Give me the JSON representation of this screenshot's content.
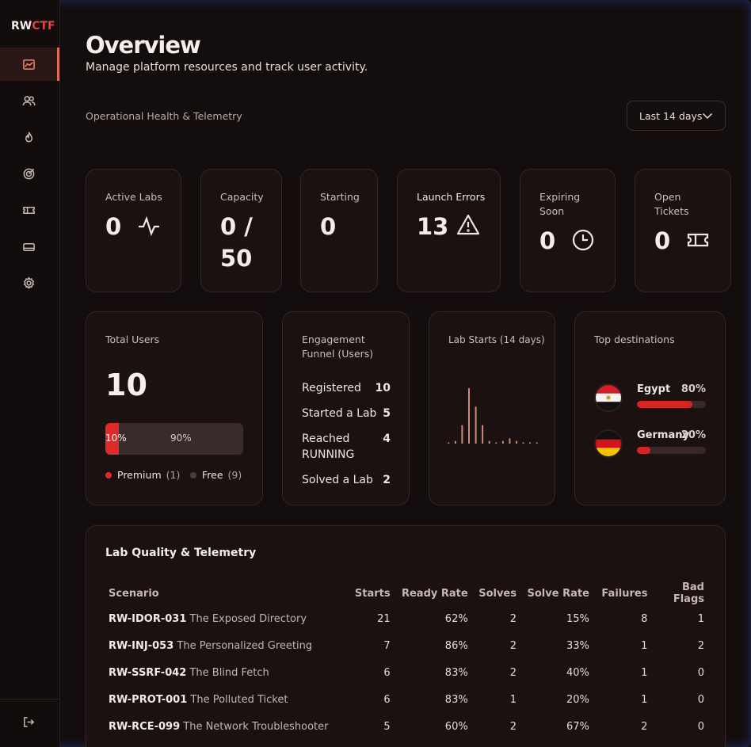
{
  "brand": {
    "part1": "RW",
    "part2": "CTF"
  },
  "nav": [
    {
      "name": "nav-overview",
      "icon": "chart-icon"
    },
    {
      "name": "nav-users",
      "icon": "users-icon"
    },
    {
      "name": "nav-flame",
      "icon": "flame-icon"
    },
    {
      "name": "nav-target",
      "icon": "target-icon"
    },
    {
      "name": "nav-tickets",
      "icon": "ticket-icon"
    },
    {
      "name": "nav-card",
      "icon": "card-icon"
    },
    {
      "name": "nav-settings",
      "icon": "gear-icon"
    }
  ],
  "header": {
    "title": "Overview",
    "subtitle": "Manage platform resources and track user activity.",
    "section_label": "Operational Health & Telemetry",
    "range": "Last 14 days"
  },
  "stats": {
    "active_labs": {
      "label": "Active Labs",
      "value": "0"
    },
    "capacity": {
      "label": "Capacity",
      "value_line1": "0 /",
      "value_line2": "50"
    },
    "starting": {
      "label": "Starting",
      "value": "0"
    },
    "launch_errors": {
      "label": "Launch Errors",
      "value": "13"
    },
    "expiring": {
      "label_line1": "Expiring",
      "label_line2": "Soon",
      "value": "0"
    },
    "tickets": {
      "label_line1": "Open",
      "label_line2": "Tickets",
      "value": "0"
    }
  },
  "users": {
    "label": "Total Users",
    "value": "10",
    "premium_pct": 10,
    "premium_text": "10%",
    "free_text": "90%",
    "premium_label": "Premium",
    "premium_count": "(1)",
    "free_label": "Free",
    "free_count": "(9)",
    "premium_color": "#e02a2a",
    "free_color": "#4a3d3b"
  },
  "funnel": {
    "label_line1": "Engagement",
    "label_line2": "Funnel (Users)",
    "rows": [
      {
        "label": "Registered",
        "value": "10"
      },
      {
        "label": "Started a Lab",
        "value": "5"
      },
      {
        "label_line1": "Reached",
        "label_line2": "RUNNING",
        "value": "4"
      },
      {
        "label": "Solved a Lab",
        "value": "2"
      }
    ]
  },
  "lab_starts": {
    "label": "Lab Starts (14 days)"
  },
  "chart_data": {
    "type": "bar",
    "title": "Lab Starts (14 days)",
    "values": [
      0,
      1,
      7,
      21,
      14,
      7,
      1,
      0,
      1,
      2,
      1,
      0,
      0,
      0
    ],
    "color": "#c98a78"
  },
  "destinations": {
    "label": "Top destinations",
    "items": [
      {
        "name": "Egypt",
        "pct_text": "80%",
        "pct": 80
      },
      {
        "name": "Germany",
        "pct_text": "20%",
        "pct": 20
      }
    ]
  },
  "quality": {
    "title": "Lab Quality & Telemetry",
    "columns": [
      "Scenario",
      "Starts",
      "Ready Rate",
      "Solves",
      "Solve Rate",
      "Failures",
      "Bad Flags"
    ],
    "rows": [
      {
        "code": "RW-IDOR-031",
        "name": "The Exposed Directory",
        "starts": "21",
        "ready": "62%",
        "solves": "2",
        "solve_rate": "15%",
        "failures": "8",
        "bad_flags": "1"
      },
      {
        "code": "RW-INJ-053",
        "name": "The Personalized Greeting",
        "starts": "7",
        "ready": "86%",
        "solves": "2",
        "solve_rate": "33%",
        "failures": "1",
        "bad_flags": "2"
      },
      {
        "code": "RW-SSRF-042",
        "name": "The Blind Fetch",
        "starts": "6",
        "ready": "83%",
        "solves": "2",
        "solve_rate": "40%",
        "failures": "1",
        "bad_flags": "0"
      },
      {
        "code": "RW-PROT-001",
        "name": "The Polluted Ticket",
        "starts": "6",
        "ready": "83%",
        "solves": "1",
        "solve_rate": "20%",
        "failures": "1",
        "bad_flags": "0"
      },
      {
        "code": "RW-RCE-099",
        "name": "The Network Troubleshooter",
        "starts": "5",
        "ready": "60%",
        "solves": "2",
        "solve_rate": "67%",
        "failures": "2",
        "bad_flags": "0"
      }
    ]
  }
}
